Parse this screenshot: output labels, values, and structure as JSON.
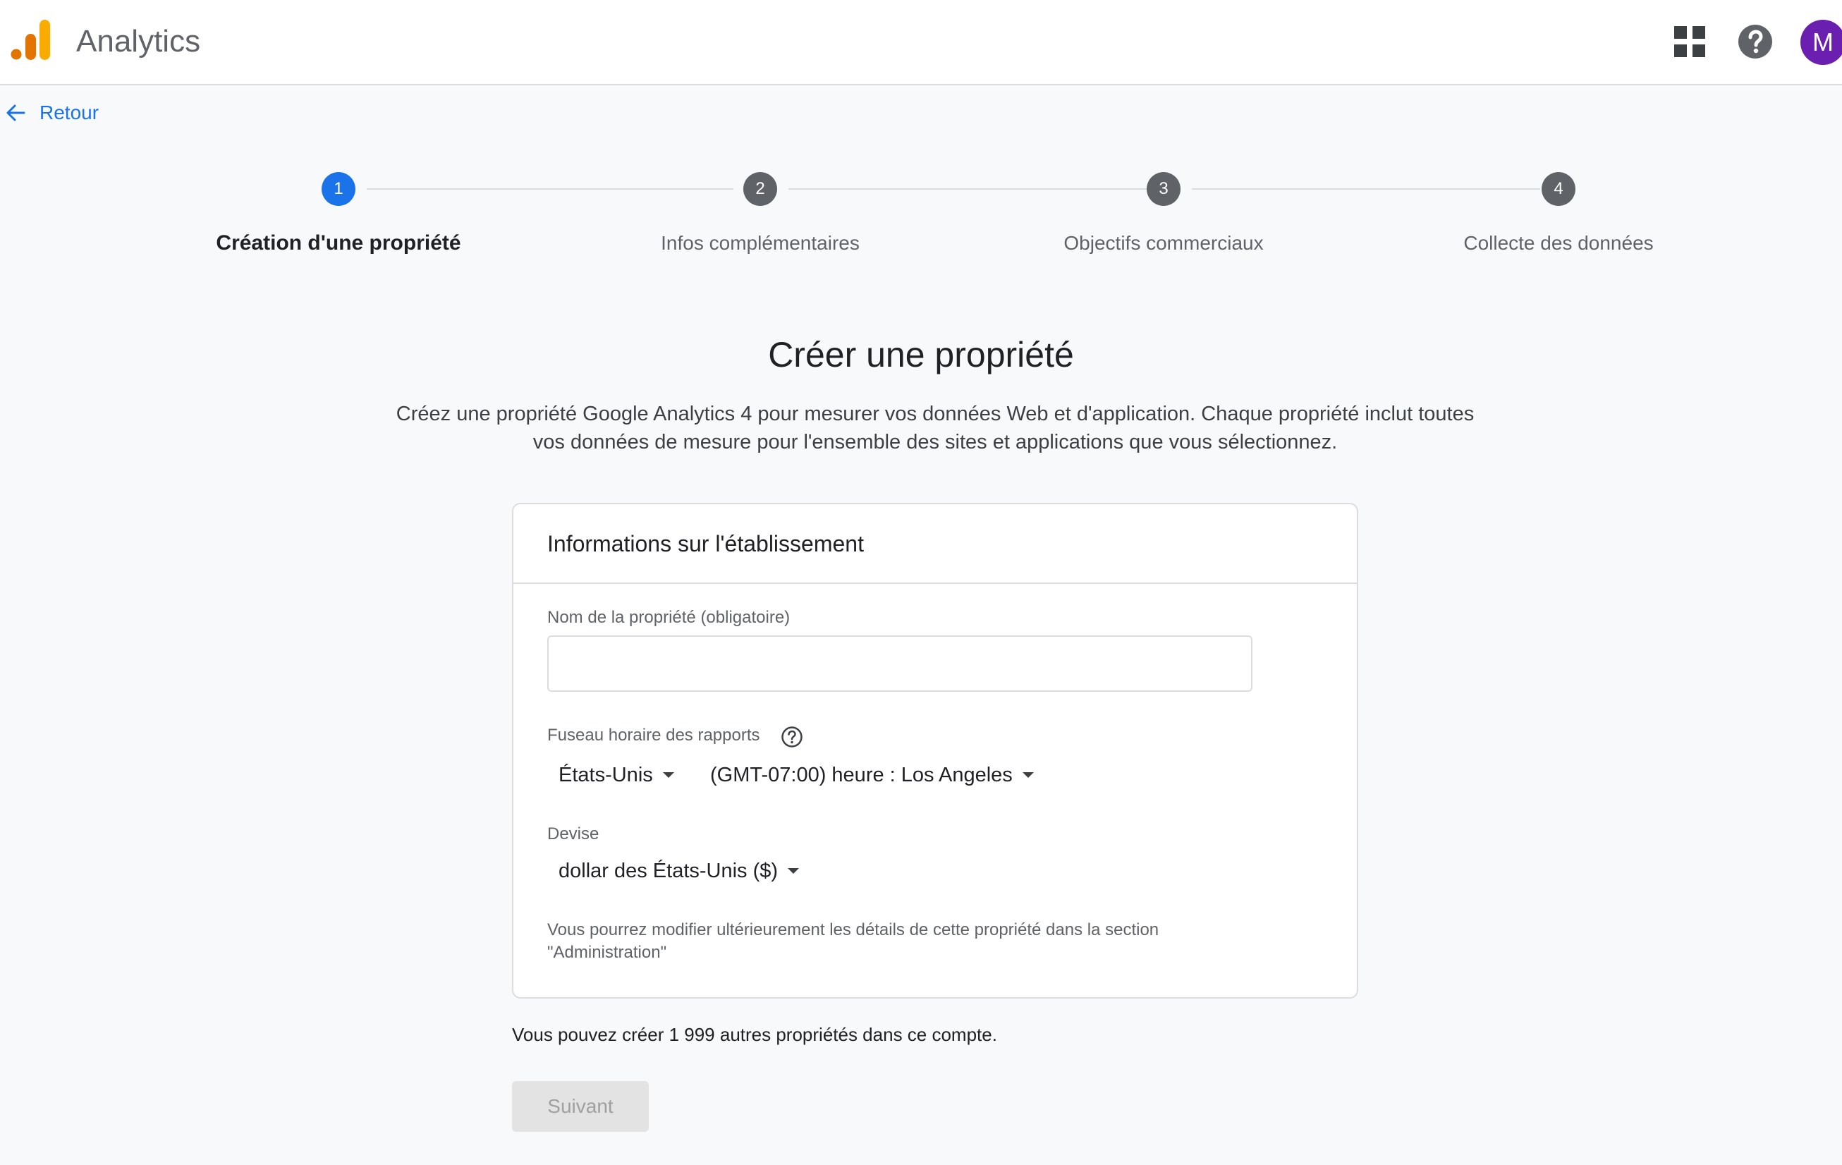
{
  "app": {
    "title": "Analytics",
    "avatar_initial": "M",
    "brand_colors": {
      "bar_light": "#f9ab00",
      "bar_dark": "#e37400",
      "avatar_bg": "#6a1fb0",
      "accent": "#1a73e8"
    },
    "icons": {
      "logo": "analytics-logo",
      "apps": "apps-grid-icon",
      "help": "help-icon"
    }
  },
  "nav": {
    "back_label": "Retour",
    "back_icon": "arrow-left-icon"
  },
  "stepper": {
    "steps": [
      {
        "number": "1",
        "label": "Création d'une propriété",
        "state": "active"
      },
      {
        "number": "2",
        "label": "Infos complémentaires",
        "state": "inactive"
      },
      {
        "number": "3",
        "label": "Objectifs commerciaux",
        "state": "inactive"
      },
      {
        "number": "4",
        "label": "Collecte des données",
        "state": "inactive"
      }
    ]
  },
  "main": {
    "title": "Créer une propriété",
    "description": "Créez une propriété Google Analytics 4 pour mesurer vos données Web et d'application. Chaque propriété inclut toutes vos données de mesure pour l'ensemble des sites et applications que vous sélectionnez."
  },
  "card": {
    "header": "Informations sur l'établissement",
    "property_name_label": "Nom de la propriété (obligatoire)",
    "property_name_value": "",
    "timezone_label": "Fuseau horaire des rapports",
    "country_value": "États-Unis",
    "timezone_value": "(GMT-07:00) heure : Los Angeles",
    "currency_label": "Devise",
    "currency_value": "dollar des États-Unis ($)",
    "note": "Vous pourrez modifier ultérieurement les détails de cette propriété dans la section \"Administration\""
  },
  "footer": {
    "remaining_text": "Vous pouvez créer 1 999 autres propriétés dans ce compte.",
    "next_label": "Suivant"
  }
}
